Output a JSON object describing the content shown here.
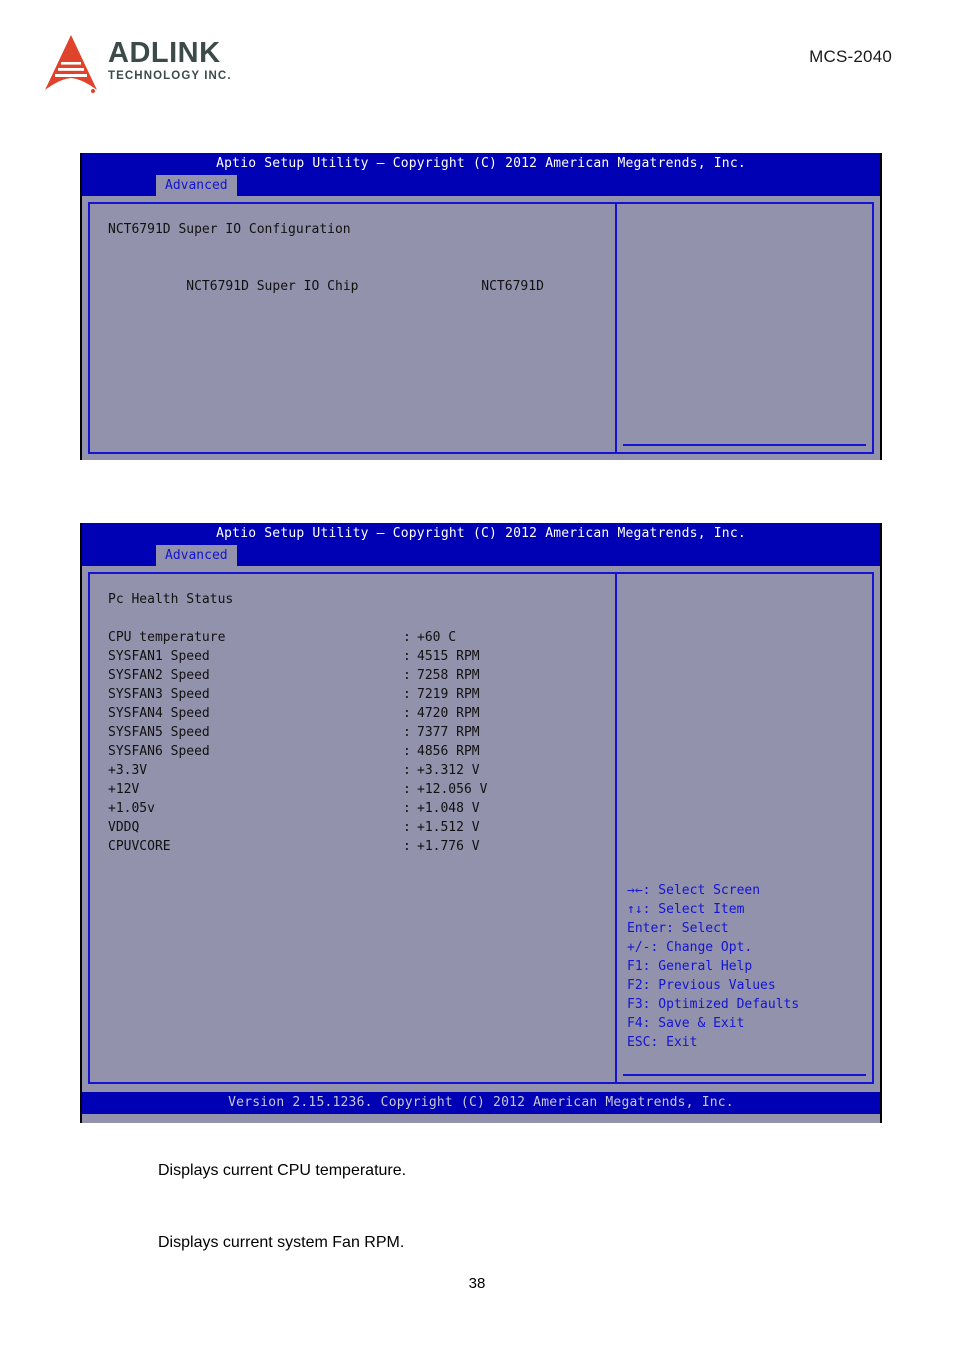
{
  "header": {
    "logo_name": "ADLINK",
    "logo_sub": "TECHNOLOGY INC.",
    "logo_icon": "adlink-arrow-logo",
    "model": "MCS-2040"
  },
  "colors": {
    "bios_title_bar": "#0000b4",
    "bios_body": "#9292ac",
    "bios_border": "#1414d2",
    "bios_help_text": "#1414d2",
    "logo_red": "#e0432c",
    "logo_dark": "#3c4a4a"
  },
  "screen1": {
    "title": "Aptio Setup Utility – Copyright (C) 2012 American Megatrends, Inc.",
    "tab": "Advanced",
    "section_title": "NCT6791D Super IO Configuration",
    "rows": [
      {
        "label": "NCT6791D Super IO Chip",
        "value": "NCT6791D"
      }
    ]
  },
  "screen2": {
    "title": "Aptio Setup Utility – Copyright (C) 2012 American Megatrends, Inc.",
    "tab": "Advanced",
    "section_title": "Pc Health Status",
    "rows": [
      {
        "label": "CPU temperature",
        "sep": ":",
        "value": "+60 C"
      },
      {
        "label": "SYSFAN1 Speed",
        "sep": ":",
        "value": "4515 RPM"
      },
      {
        "label": "SYSFAN2 Speed",
        "sep": ":",
        "value": "7258 RPM"
      },
      {
        "label": "SYSFAN3 Speed",
        "sep": ":",
        "value": "7219 RPM"
      },
      {
        "label": "SYSFAN4 Speed",
        "sep": ":",
        "value": "4720 RPM"
      },
      {
        "label": "SYSFAN5 Speed",
        "sep": ":",
        "value": "7377 RPM"
      },
      {
        "label": "SYSFAN6 Speed",
        "sep": ":",
        "value": "4856 RPM"
      },
      {
        "label": "+3.3V",
        "sep": ":",
        "value": "+3.312 V"
      },
      {
        "label": "+12V",
        "sep": ":",
        "value": "+12.056 V"
      },
      {
        "label": "+1.05v",
        "sep": ":",
        "value": "+1.048 V"
      },
      {
        "label": "VDDQ",
        "sep": ":",
        "value": "+1.512 V"
      },
      {
        "label": "CPUVCORE",
        "sep": ":",
        "value": "+1.776 V"
      }
    ],
    "help": [
      "→←: Select Screen",
      "↑↓: Select Item",
      "Enter: Select",
      "+/-: Change Opt.",
      "F1: General Help",
      "F2: Previous Values",
      "F3: Optimized Defaults",
      "F4: Save & Exit",
      "ESC: Exit"
    ],
    "footer": "Version 2.15.1236. Copyright (C) 2012 American Megatrends, Inc."
  },
  "body": {
    "paragraph1": "Displays current CPU temperature.",
    "paragraph2": "Displays current system Fan RPM.",
    "page_number": "38"
  }
}
